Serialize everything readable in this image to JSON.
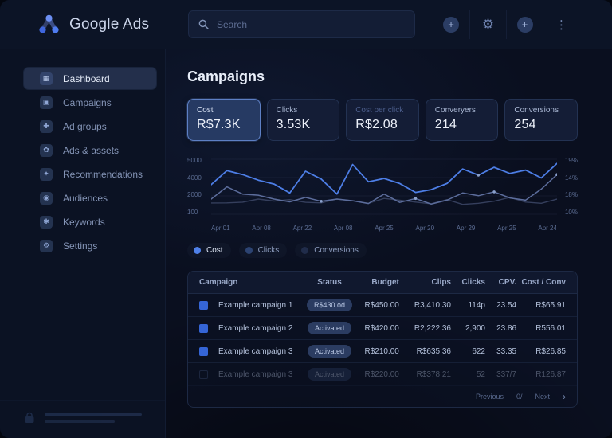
{
  "header": {
    "brand": "Google Ads",
    "search_placeholder": "Search",
    "icons": [
      {
        "name": "add-circle-icon",
        "glyph": "+",
        "style": "circle"
      },
      {
        "name": "gear-icon",
        "glyph": "⚙",
        "style": "plain"
      },
      {
        "name": "add-circle-icon-2",
        "glyph": "+",
        "style": "circle"
      },
      {
        "name": "kebab-menu-icon",
        "glyph": "⋮",
        "style": "kebab"
      }
    ]
  },
  "sidebar": {
    "items": [
      {
        "label": "Dashboard",
        "icon": "dashboard-icon",
        "glyph": "▦",
        "active": true
      },
      {
        "label": "Campaigns",
        "icon": "campaigns-icon",
        "glyph": "▣",
        "active": false
      },
      {
        "label": "Ad groups",
        "icon": "ad-groups-icon",
        "glyph": "✚",
        "active": false
      },
      {
        "label": "Ads & assets",
        "icon": "ads-assets-icon",
        "glyph": "✿",
        "active": false
      },
      {
        "label": "Recommendations",
        "icon": "recommendations-icon",
        "glyph": "✦",
        "active": false
      },
      {
        "label": "Audiences",
        "icon": "audiences-icon",
        "glyph": "◉",
        "active": false
      },
      {
        "label": "Keywords",
        "icon": "keywords-icon",
        "glyph": "✱",
        "active": false
      },
      {
        "label": "Settings",
        "icon": "settings-icon",
        "glyph": "⚙",
        "active": false
      }
    ]
  },
  "main": {
    "title": "Campaigns",
    "cards": [
      {
        "label": "Cost",
        "value": "R$7.3K",
        "selected": true,
        "muted_label": false
      },
      {
        "label": "Clicks",
        "value": "3.53K",
        "selected": false,
        "muted_label": false
      },
      {
        "label": "Cost per click",
        "value": "R$2.08",
        "selected": false,
        "muted_label": true
      },
      {
        "label": "Converyers",
        "value": "214",
        "selected": false,
        "muted_label": false
      },
      {
        "label": "Conversions",
        "value": "254",
        "selected": false,
        "muted_label": false
      }
    ],
    "legend": [
      {
        "label": "Cost",
        "color": "#4f80e8",
        "on": true
      },
      {
        "label": "Clicks",
        "color": "#2c4372",
        "on": false
      },
      {
        "label": "Conversions",
        "color": "#202c4a",
        "on": false
      }
    ],
    "table": {
      "columns": [
        "Campaign",
        "Status",
        "Budget",
        "Clips",
        "Clicks",
        "CPV.",
        "Cost / Conv"
      ],
      "rows": [
        {
          "checked": true,
          "dim": false,
          "name": "Example campaign 1",
          "status": "R$430.od",
          "budget": "R$450.00",
          "clips": "R3,410.30",
          "clicks": "114p",
          "cpv": "23.54",
          "cost_conv": "R$65.91"
        },
        {
          "checked": true,
          "dim": false,
          "name": "Example campaign 2",
          "status": "Activated",
          "budget": "R$420.00",
          "clips": "R2,222.36",
          "clicks": "2,900",
          "cpv": "23.86",
          "cost_conv": "R556.01"
        },
        {
          "checked": true,
          "dim": false,
          "name": "Example campaign 3",
          "status": "Activated",
          "budget": "R$210.00",
          "clips": "R$635.36",
          "clicks": "622",
          "cpv": "33.35",
          "cost_conv": "R$26.85"
        },
        {
          "checked": false,
          "dim": true,
          "name": "Example campaign 3",
          "status": "Activated",
          "budget": "R$220.00",
          "clips": "R$378.21",
          "clicks": "52",
          "cpv": "337/7",
          "cost_conv": "R126.87"
        }
      ],
      "pagination": {
        "previous": "Previous",
        "page": "0/",
        "next": "Next",
        "arrow": "›"
      }
    }
  },
  "chart_data": {
    "type": "line",
    "title": "",
    "xlabel": "",
    "ylabel": "",
    "x_labels": [
      "Apr 01",
      "Apr 08",
      "Apr 22",
      "Apr 08",
      "Apr 25",
      "Apr 20",
      "Apr 29",
      "Apr 25",
      "Apr 24"
    ],
    "y_left_labels": [
      "5000",
      "4000",
      "2000",
      "100"
    ],
    "y_right_labels": [
      "19%",
      "14%",
      "18%",
      "10%"
    ],
    "ylim": [
      0,
      5000
    ],
    "grid": true,
    "legend_position": "bottom",
    "series": [
      {
        "name": "Cost",
        "color": "#4d7ee6",
        "width": 1.8,
        "values": [
          2800,
          4050,
          3700,
          3200,
          2850,
          2050,
          4000,
          3300,
          1950,
          4600,
          3050,
          3350,
          2900,
          2100,
          2350,
          2900,
          4200,
          3650,
          4350,
          3800,
          4100,
          3400,
          4700
        ]
      },
      {
        "name": "Clicks",
        "color": "#5c6d9c",
        "width": 1.5,
        "values": [
          1500,
          2600,
          1950,
          1850,
          1500,
          1250,
          1650,
          1300,
          1500,
          1350,
          1100,
          1950,
          1200,
          1550,
          1050,
          1400,
          2050,
          1800,
          2150,
          1600,
          1400,
          2400,
          3700
        ]
      },
      {
        "name": "Conversions",
        "color": "#353f5d",
        "width": 1.4,
        "values": [
          1150,
          1160,
          1220,
          1500,
          1320,
          1450,
          1210,
          1160,
          1500,
          1340,
          1120,
          1560,
          1400,
          1230,
          1080,
          1450,
          1020,
          1120,
          1310,
          1650,
          1230,
          1120,
          1500
        ]
      }
    ],
    "markers": [
      {
        "series": 1,
        "points": [
          7,
          13,
          18,
          22
        ]
      },
      {
        "series": 0,
        "points": [
          17
        ]
      }
    ]
  }
}
